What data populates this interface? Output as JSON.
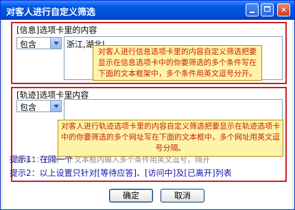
{
  "window": {
    "title": "对客人进行自定义筛选",
    "controls": {
      "minimize": "minimize-icon",
      "maximize": "maximize-icon",
      "close": "close-icon"
    }
  },
  "section_info": {
    "label": "[信息]选项卡里的内容",
    "combo_value": "包含",
    "textbox_value": "浙江,湖北|",
    "tooltip": "对客人进行信息选项卡里的内容自定义筛选把要显示在信息选项卡中的你要筛选的多个条件写在下面的文本框架中，多个条件用英文逗号分开。"
  },
  "section_track": {
    "label": "[轨迹]选项卡里内容",
    "combo_value": "包含",
    "textbox_value": "",
    "tooltip": "对客人进行轨迹选项卡里的内容自定义筛选把要显示在轨迹选项卡中的你要筛选的多个网址写在下面的文本框中，多个网址用英文逗号分隔。",
    "faded_text": "提示1：在同一个文本框内输入多个条件用英文逗号，隔开"
  },
  "hints": {
    "hint1": "提示1：在同一个",
    "hint2": "提示2：以上设置只针对[等待应答]、[访问中]及[已离开]列表"
  },
  "buttons": {
    "ok": "确定",
    "cancel": "取消"
  },
  "colors": {
    "title_bar": "#0058e6",
    "section_border": "#cc1b1b",
    "tooltip_bg": "#fff3a8",
    "tooltip_text": "#c62200",
    "hint_text": "#1212a8"
  }
}
